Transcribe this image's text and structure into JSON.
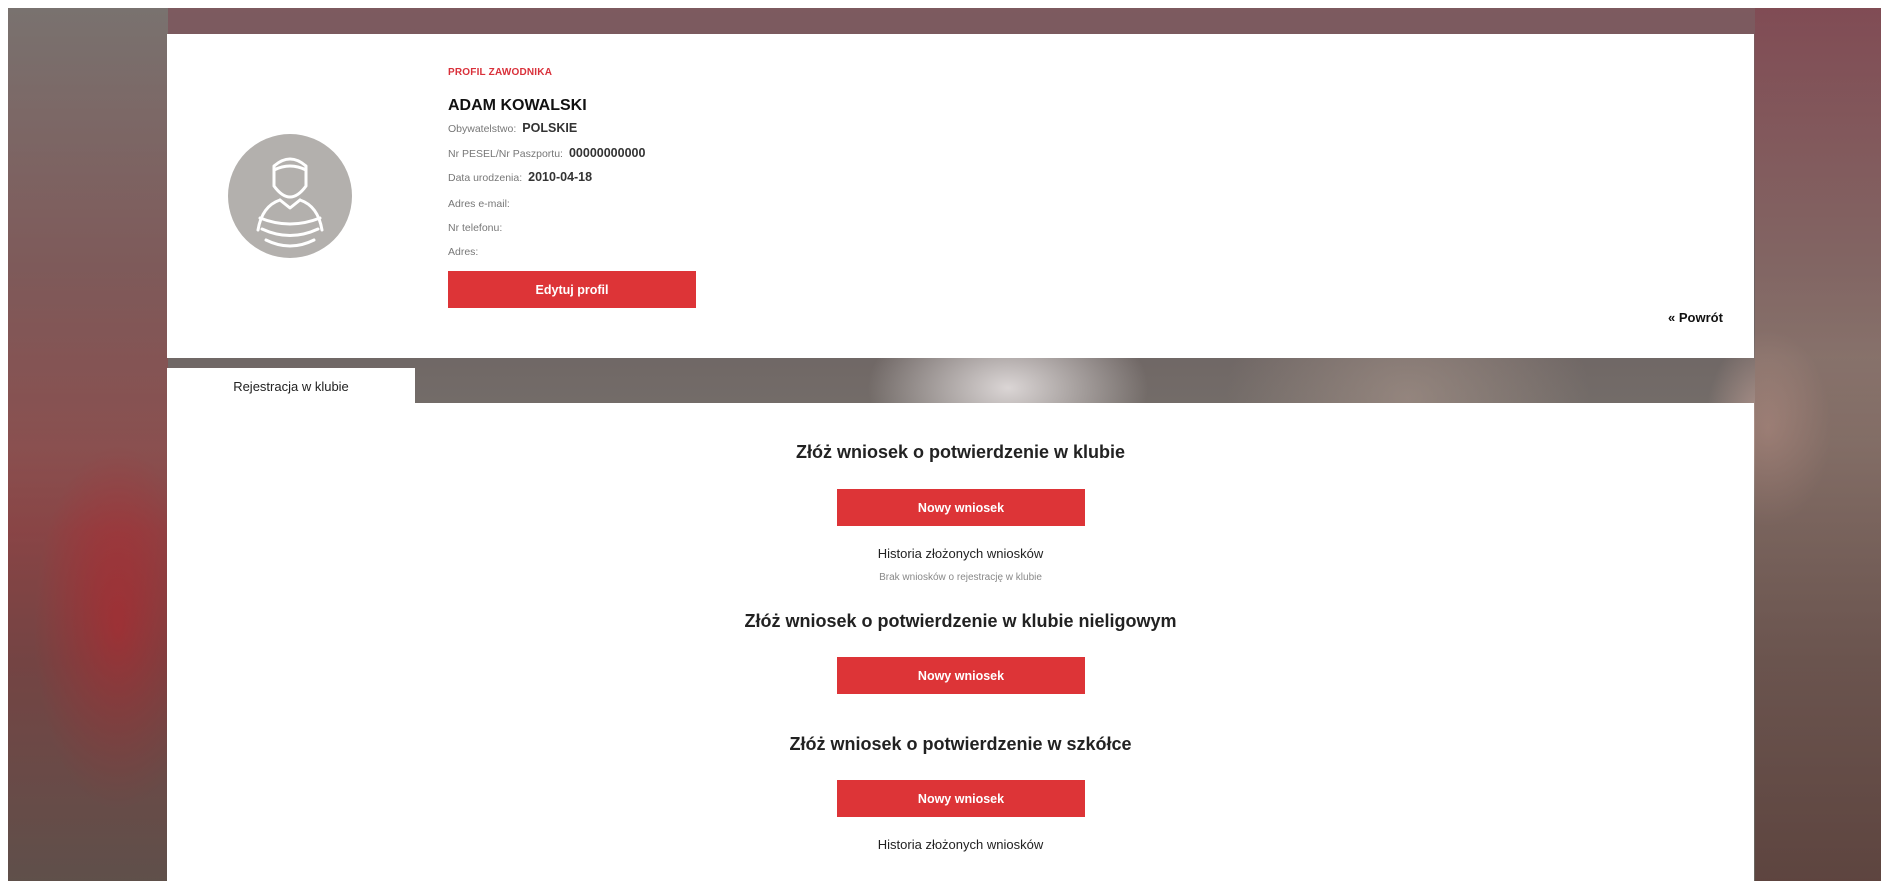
{
  "profile": {
    "kicker": "PROFIL ZAWODNIKA",
    "name": "ADAM KOWALSKI",
    "fields": [
      {
        "label": "Obywatelstwo:",
        "value": "POLSKIE"
      },
      {
        "label": "Nr PESEL/Nr Paszportu:",
        "value": "00000000000"
      },
      {
        "label": "Data urodzenia:",
        "value": "2010-04-18"
      },
      {
        "label": "Adres e-mail:",
        "value": ""
      },
      {
        "label": "Nr telefonu:",
        "value": ""
      },
      {
        "label": "Adres:",
        "value": ""
      }
    ],
    "edit_label": "Edytuj profil",
    "back_label": "« Powrót",
    "avatar_icon": "user-avatar-icon"
  },
  "tabs": [
    {
      "label": "Rejestracja w klubie"
    }
  ],
  "sections": [
    {
      "title": "Złóż wniosek o potwierdzenie w klubie",
      "button": "Nowy wniosek",
      "history": "Historia złożonych wniosków",
      "empty": "Brak wniosków o rejestrację w klubie"
    },
    {
      "title": "Złóż wniosek o potwierdzenie w klubie nieligowym",
      "button": "Nowy wniosek"
    },
    {
      "title": "Złóż wniosek o potwierdzenie w szkółce",
      "button": "Nowy wniosek",
      "history": "Historia złożonych wniosków"
    }
  ],
  "colors": {
    "accent": "#dd3437",
    "panel": "#ffffff",
    "avatar": "#b3b0ad"
  }
}
